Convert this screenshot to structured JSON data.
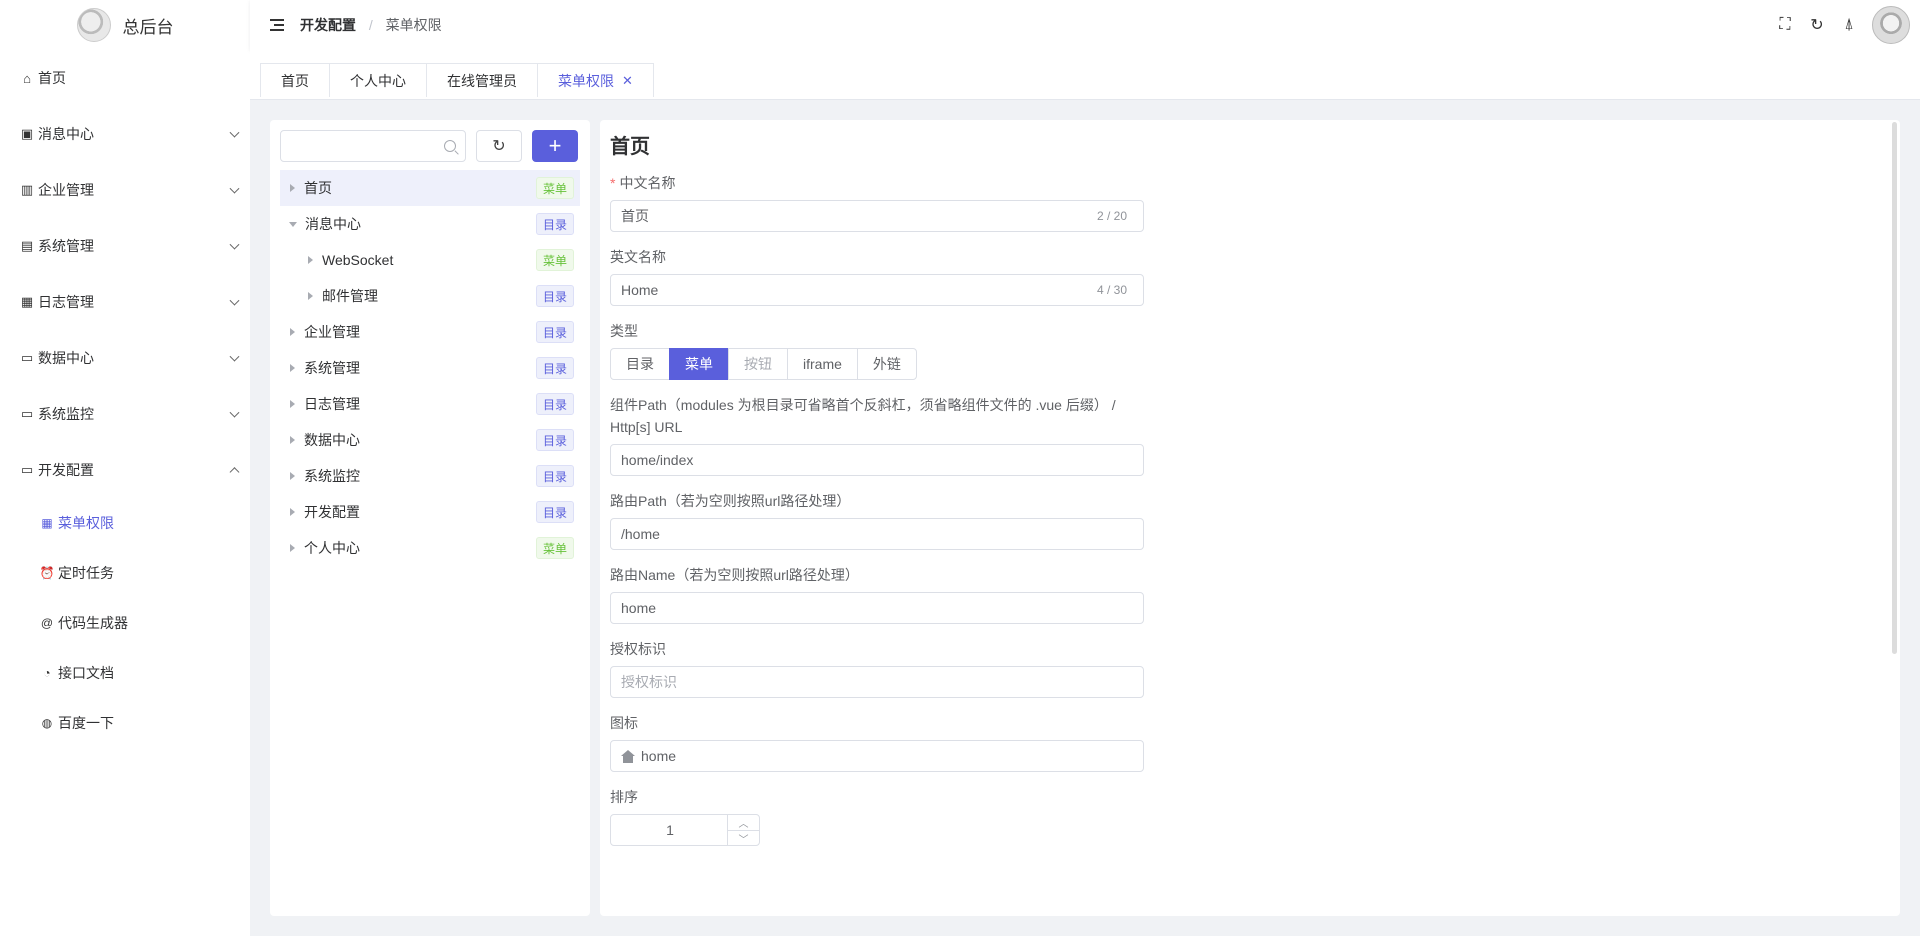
{
  "app": {
    "title": "总后台"
  },
  "sidebar": {
    "items": [
      {
        "label": "首页",
        "icon": "home-icon",
        "glyph": "⌂",
        "expandable": false
      },
      {
        "label": "消息中心",
        "icon": "chat-icon",
        "glyph": "▣",
        "expandable": true
      },
      {
        "label": "企业管理",
        "icon": "chart-icon",
        "glyph": "▥",
        "expandable": true
      },
      {
        "label": "系统管理",
        "icon": "computer-icon",
        "glyph": "▤",
        "expandable": true
      },
      {
        "label": "日志管理",
        "icon": "log-icon",
        "glyph": "▦",
        "expandable": true
      },
      {
        "label": "数据中心",
        "icon": "monitor-icon",
        "glyph": "▭",
        "expandable": true
      },
      {
        "label": "系统监控",
        "icon": "monitor-icon",
        "glyph": "▭",
        "expandable": true
      },
      {
        "label": "开发配置",
        "icon": "monitor-icon",
        "glyph": "▭",
        "expandable": true,
        "expanded": true
      }
    ],
    "sub_items": [
      {
        "label": "菜单权限",
        "icon": "grid-icon",
        "glyph": "▦",
        "active": true
      },
      {
        "label": "定时任务",
        "icon": "alarm-clock-icon",
        "glyph": "⏰"
      },
      {
        "label": "代码生成器",
        "icon": "at-sign-icon",
        "glyph": "@"
      },
      {
        "label": "接口文档",
        "icon": "pacman-icon",
        "glyph": "◔"
      },
      {
        "label": "百度一下",
        "icon": "globe-icon",
        "glyph": "◍"
      }
    ]
  },
  "header": {
    "breadcrumb": [
      "开发配置",
      "菜单权限"
    ],
    "separator": "/"
  },
  "tabs": [
    {
      "label": "首页"
    },
    {
      "label": "个人中心"
    },
    {
      "label": "在线管理员"
    },
    {
      "label": "菜单权限",
      "active": true,
      "closable": true
    }
  ],
  "tree": {
    "search_placeholder": "",
    "nodes": [
      {
        "label": "首页",
        "tag": "菜单",
        "tag_type": "menu",
        "level": 0,
        "expanded": false,
        "selected": true
      },
      {
        "label": "消息中心",
        "tag": "目录",
        "tag_type": "dir",
        "level": 0,
        "expanded": true
      },
      {
        "label": "WebSocket",
        "tag": "菜单",
        "tag_type": "menu",
        "level": 1,
        "expanded": false
      },
      {
        "label": "邮件管理",
        "tag": "目录",
        "tag_type": "dir",
        "level": 1,
        "expanded": false
      },
      {
        "label": "企业管理",
        "tag": "目录",
        "tag_type": "dir",
        "level": 0,
        "expanded": false
      },
      {
        "label": "系统管理",
        "tag": "目录",
        "tag_type": "dir",
        "level": 0,
        "expanded": false
      },
      {
        "label": "日志管理",
        "tag": "目录",
        "tag_type": "dir",
        "level": 0,
        "expanded": false
      },
      {
        "label": "数据中心",
        "tag": "目录",
        "tag_type": "dir",
        "level": 0,
        "expanded": false
      },
      {
        "label": "系统监控",
        "tag": "目录",
        "tag_type": "dir",
        "level": 0,
        "expanded": false
      },
      {
        "label": "开发配置",
        "tag": "目录",
        "tag_type": "dir",
        "level": 0,
        "expanded": false
      },
      {
        "label": "个人中心",
        "tag": "菜单",
        "tag_type": "menu",
        "level": 0,
        "expanded": false
      }
    ]
  },
  "form": {
    "title": "首页",
    "cn_name": {
      "label": "中文名称",
      "required_mark": "*",
      "value": "首页",
      "count": "2 / 20"
    },
    "en_name": {
      "label": "英文名称",
      "value": "Home",
      "count": "4 / 30"
    },
    "type": {
      "label": "类型",
      "options": [
        {
          "label": "目录"
        },
        {
          "label": "菜单",
          "active": true
        },
        {
          "label": "按钮",
          "disabled": true
        },
        {
          "label": "iframe"
        },
        {
          "label": "外链"
        }
      ]
    },
    "component_path": {
      "label_line1": "组件Path（modules 为根目录可省略首个反斜杠，须省略组件文件的 .vue 后缀） /",
      "label_line2": "Http[s] URL",
      "value": "home/index"
    },
    "route_path": {
      "label": "路由Path（若为空则按照url路径处理）",
      "value": "/home"
    },
    "route_name": {
      "label": "路由Name（若为空则按照url路径处理）",
      "value": "home"
    },
    "permission": {
      "label": "授权标识",
      "placeholder": "授权标识"
    },
    "icon": {
      "label": "图标",
      "value": "home"
    },
    "sort": {
      "label": "排序",
      "value": "1"
    }
  },
  "colors": {
    "primary": "#5a5fdc",
    "menu_tag": "#67c23a"
  }
}
